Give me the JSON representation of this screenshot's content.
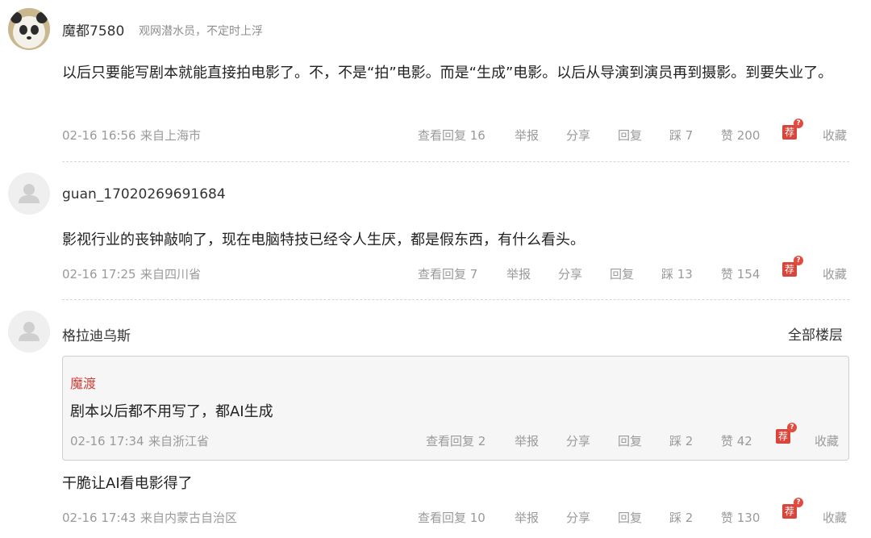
{
  "comments": [
    {
      "username": "魔都7580",
      "tag": "观网潜水员，不定时上浮",
      "body": "以后只要能写剧本就能直接拍电影了。不，不是“拍”电影。而是“生成”电影。以后从导演到演员再到摄影。到要失业了。",
      "time": "02-16 16:56",
      "location": "来自上海市",
      "view_replies": "查看回复 16",
      "report": "举报",
      "share": "分享",
      "reply": "回复",
      "dislike": "踩 7",
      "like": "赞 200",
      "collect": "收藏"
    },
    {
      "username": "guan_17020269691684",
      "body": "影视行业的丧钟敲响了，现在电脑特技已经令人生厌，都是假东西，有什么看头。",
      "time": "02-16 17:25",
      "location": "来自四川省",
      "view_replies": "查看回复 7",
      "report": "举报",
      "share": "分享",
      "reply": "回复",
      "dislike": "踩 13",
      "like": "赞 154",
      "collect": "收藏"
    },
    {
      "username": "格拉迪乌斯",
      "all_floors": "全部楼层",
      "quoted": {
        "username": "魔渡",
        "body": "剧本以后都不用写了，都AI生成",
        "time": "02-16 17:34",
        "location": "来自浙江省",
        "view_replies": "查看回复 2",
        "report": "举报",
        "share": "分享",
        "reply": "回复",
        "dislike": "踩 2",
        "like": "赞 42",
        "collect": "收藏"
      },
      "body": "干脆让AI看电影得了",
      "time": "02-16 17:43",
      "location": "来自内蒙古自治区",
      "view_replies": "查看回复 10",
      "report": "举报",
      "share": "分享",
      "reply": "回复",
      "dislike": "踩 2",
      "like": "赞 130",
      "collect": "收藏"
    }
  ],
  "recommend_icon": {
    "glyph": "荐",
    "badge": "?"
  },
  "colors": {
    "accent_red": "#d8453a",
    "meta_gray": "#9a9a9a",
    "quote_username": "#d0413b"
  }
}
